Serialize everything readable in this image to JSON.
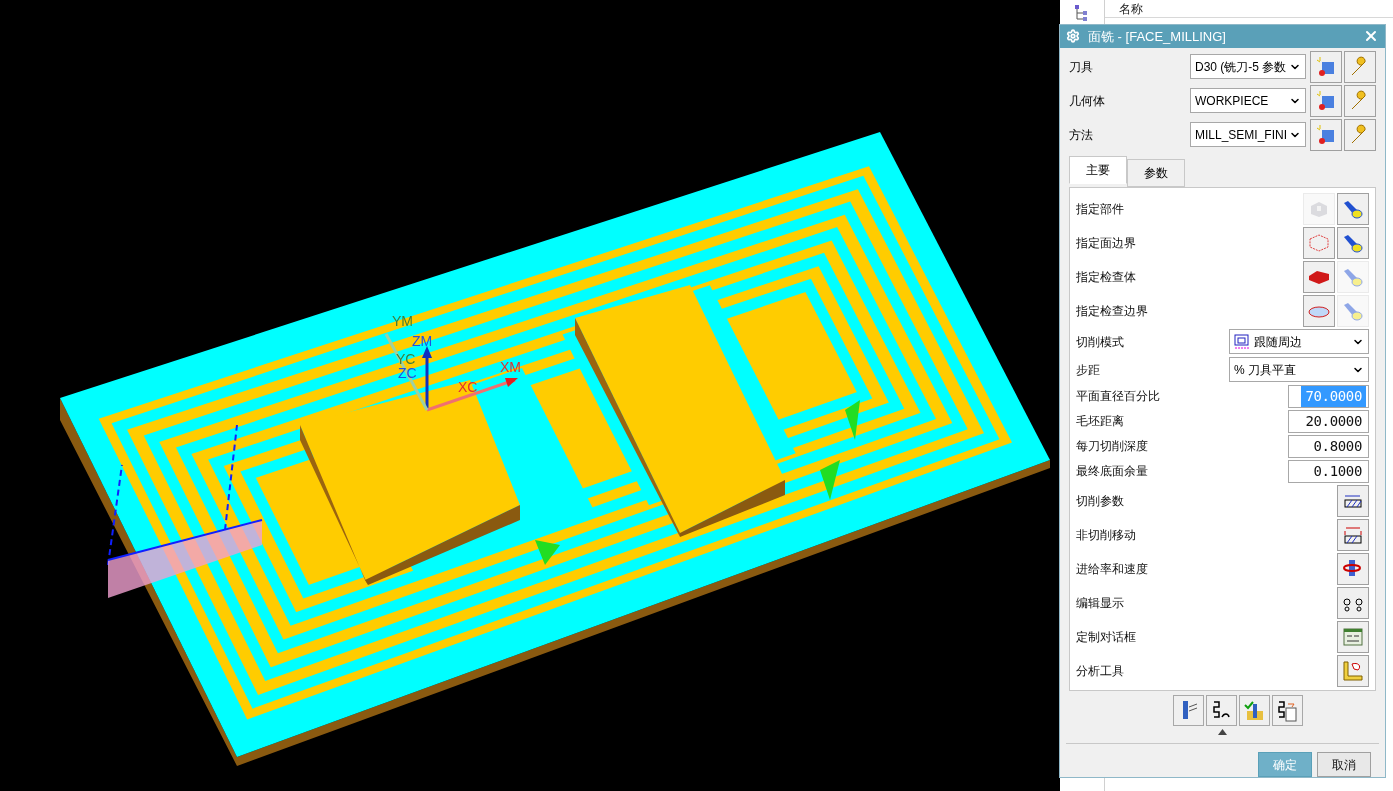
{
  "viewport": {
    "axis_labels": [
      {
        "text": "YM",
        "kind": "y"
      },
      {
        "text": "ZM",
        "kind": "z"
      },
      {
        "text": "YC",
        "kind": "y"
      },
      {
        "text": "ZC",
        "kind": "z"
      },
      {
        "text": "XC",
        "kind": "x"
      },
      {
        "text": "XM",
        "kind": "x"
      }
    ]
  },
  "navigator": {
    "column_header": "名称"
  },
  "dialog": {
    "title": "面铣 - [FACE_MILLING]",
    "selectors": [
      {
        "label": "刀具",
        "value": "D30 (铣刀-5 参数"
      },
      {
        "label": "几何体",
        "value": "WORKPIECE"
      },
      {
        "label": "方法",
        "value": "MILL_SEMI_FINI"
      }
    ],
    "tabs": [
      {
        "label": "主要",
        "selected": true
      },
      {
        "label": "参数",
        "selected": false
      }
    ],
    "rows": [
      {
        "kind": "geometry",
        "label": "指定部件",
        "select_disabled": true,
        "display_disabled": false
      },
      {
        "kind": "geometry",
        "label": "指定面边界",
        "select_disabled": false,
        "display_disabled": false
      },
      {
        "kind": "geometry",
        "label": "指定检查体",
        "select_disabled": false,
        "display_disabled": true
      },
      {
        "kind": "geometry",
        "label": "指定检查边界",
        "select_disabled": false,
        "display_disabled": true
      },
      {
        "kind": "dropdown",
        "label": "切削模式",
        "value": "跟随周边",
        "has_icon": true
      },
      {
        "kind": "dropdown",
        "label": "步距",
        "value": "% 刀具平直",
        "has_icon": false
      },
      {
        "kind": "number",
        "label": "平面直径百分比",
        "value": "70.0000",
        "selected": true
      },
      {
        "kind": "number",
        "label": "毛坯距离",
        "value": "20.0000",
        "selected": false
      },
      {
        "kind": "number",
        "label": "每刀切削深度",
        "value": "0.8000",
        "selected": false
      },
      {
        "kind": "number",
        "label": "最终底面余量",
        "value": "0.1000",
        "selected": false
      },
      {
        "kind": "action",
        "label": "切削参数"
      },
      {
        "kind": "action",
        "label": "非切削移动"
      },
      {
        "kind": "action",
        "label": "进给率和速度"
      },
      {
        "kind": "action",
        "label": "编辑显示"
      },
      {
        "kind": "action",
        "label": "定制对话框"
      },
      {
        "kind": "action",
        "label": "分析工具"
      }
    ],
    "buttons": [
      {
        "label": "确定",
        "primary": true
      },
      {
        "label": "取消",
        "primary": false
      }
    ]
  }
}
